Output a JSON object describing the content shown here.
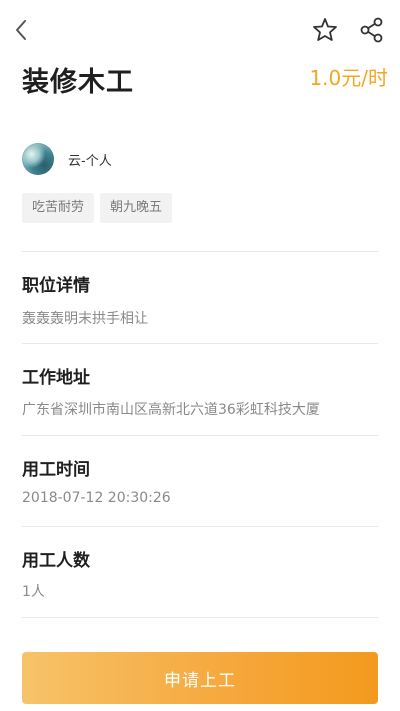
{
  "job": {
    "title": "装修木工",
    "price": "1.0元/时"
  },
  "owner": {
    "name": "云-个人"
  },
  "tags": [
    "吃苦耐劳",
    "朝九晚五"
  ],
  "sections": {
    "detail": {
      "title": "职位详情",
      "value": "轰轰轰明末拱手相让"
    },
    "address": {
      "title": "工作地址",
      "value": "广东省深圳市南山区高新北六道36彩虹科技大厦"
    },
    "time": {
      "title": "用工时间",
      "value": "2018-07-12 20:30:26"
    },
    "count": {
      "title": "用工人数",
      "value": "1人"
    }
  },
  "actions": {
    "apply_label": "申请上工"
  },
  "colors": {
    "accent": "#f5a623",
    "title_text": "#1f1f1f",
    "muted_text": "#8a8a8a",
    "tag_bg": "#f2f2f2"
  },
  "icons": {
    "back": "chevron-left-icon",
    "favorite": "star-outline-icon",
    "share": "share-icon"
  }
}
